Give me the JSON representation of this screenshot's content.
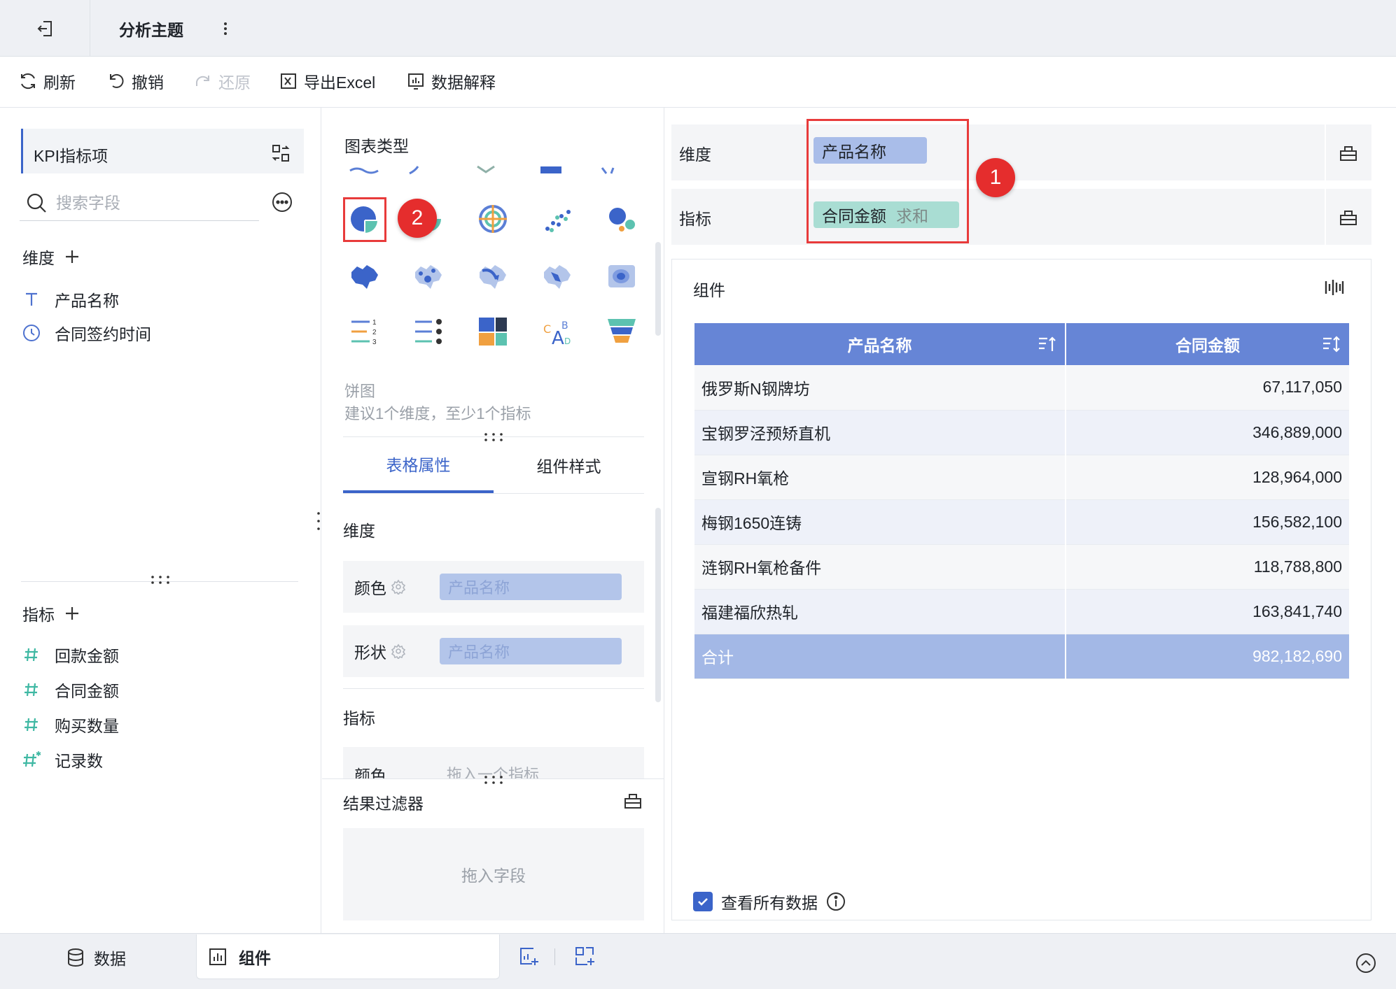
{
  "header": {
    "title": "分析主题"
  },
  "toolbar": {
    "refresh": "刷新",
    "undo": "撤销",
    "redo": "还原",
    "export": "导出Excel",
    "explain": "数据解释"
  },
  "left_panel": {
    "dataset": "KPI指标项",
    "search_placeholder": "搜索字段",
    "dimensions_title": "维度",
    "dimensions": [
      "产品名称",
      "合同签约时间"
    ],
    "measures_title": "指标",
    "measures": [
      "回款金额",
      "合同金额",
      "购买数量",
      "记录数"
    ]
  },
  "middle_panel": {
    "chart_type_title": "图表类型",
    "selected_chart_name": "饼图",
    "selected_chart_hint": "建议1个维度，至少1个指标",
    "tabs": [
      "表格属性",
      "组件样式"
    ],
    "dimension_section": "维度",
    "color_label": "颜色",
    "shape_label": "形状",
    "color_pill": "产品名称",
    "shape_pill": "产品名称",
    "measure_section": "指标",
    "measure_color_label": "颜色",
    "measure_color_placeholder": "拖入一个指标",
    "filter_title": "结果过滤器",
    "filter_placeholder": "拖入字段"
  },
  "right_panel": {
    "dimension_label": "维度",
    "dimension_pill": "产品名称",
    "measure_label": "指标",
    "measure_pill": "合同金额",
    "measure_agg": "求和",
    "widget_title": "组件",
    "table": {
      "columns": [
        "产品名称",
        "合同金额"
      ],
      "rows": [
        [
          "俄罗斯N钢牌坊",
          "67,117,050"
        ],
        [
          "宝钢罗泾预矫直机",
          "346,889,000"
        ],
        [
          "宣钢RH氧枪",
          "128,964,000"
        ],
        [
          "梅钢1650连铸",
          "156,582,100"
        ],
        [
          "涟钢RH氧枪备件",
          "118,788,800"
        ],
        [
          "福建福欣热轧",
          "163,841,740"
        ]
      ],
      "total": [
        "合计",
        "982,182,690"
      ]
    },
    "show_all_label": "查看所有数据",
    "show_all_checked": true
  },
  "annotations": {
    "badge1": "1",
    "badge2": "2"
  },
  "bottombar": {
    "data_tab": "数据",
    "widget_tab": "组件"
  },
  "colors": {
    "accent": "#3b64c9",
    "table_header": "#6685d6",
    "annotation_red": "#e52d2d",
    "dimension_pill": "#b3c5ea",
    "measure_pill": "#a9ddd3"
  }
}
